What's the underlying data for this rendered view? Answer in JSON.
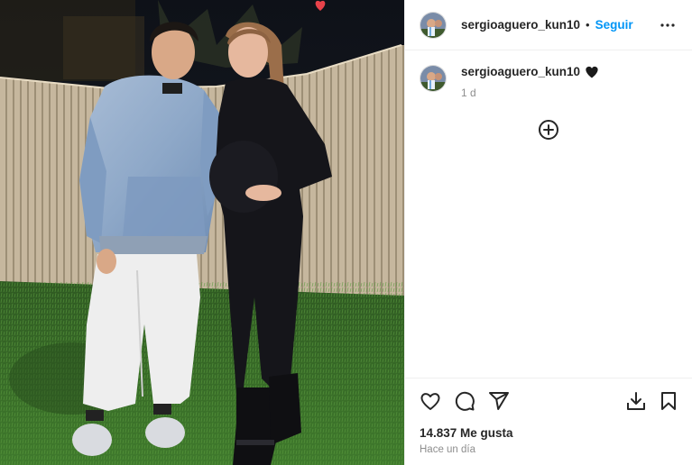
{
  "post": {
    "username": "sergioaguero_kun10",
    "follow_label": "Seguir",
    "separator": "•",
    "caption_username": "sergioaguero_kun10",
    "caption_emoji": "black-heart",
    "relative_time": "1 d",
    "likes_text": "14.837 Me gusta",
    "posted_text": "Hace un día"
  },
  "icons": {
    "more": "more-horizontal-icon",
    "load_more": "plus-circle-icon",
    "like": "heart-outline-icon",
    "comment": "comment-icon",
    "share": "send-icon",
    "download": "download-icon",
    "save": "bookmark-icon",
    "reaction": "red-heart-icon"
  },
  "colors": {
    "accent": "#0095f6",
    "text": "#262626",
    "muted": "#8e8e8e",
    "divider": "#efefef"
  }
}
